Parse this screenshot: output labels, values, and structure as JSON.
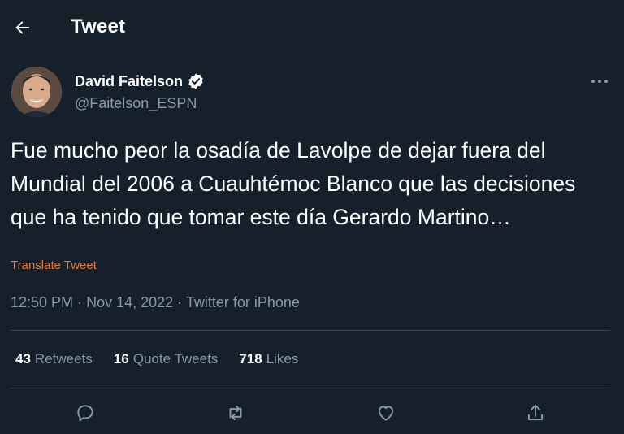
{
  "header": {
    "title": "Tweet",
    "back_icon": "arrow-left-icon"
  },
  "tweet": {
    "author": {
      "name": "David Faitelson",
      "handle": "@Faitelson_ESPN",
      "verified": true
    },
    "text": "Fue mucho peor la osadía de Lavolpe de dejar fuera del Mundial del 2006 a Cuauhtémoc Blanco que las decisiones que ha tenido que tomar este día Gerardo Martino…",
    "translate_label": "Translate Tweet",
    "time": "12:50 PM",
    "date": "Nov 14, 2022",
    "separator": "·",
    "source": "Twitter for iPhone",
    "stats": {
      "retweets_count": "43",
      "retweets_label": "Retweets",
      "quotes_count": "16",
      "quotes_label": "Quote Tweets",
      "likes_count": "718",
      "likes_label": "Likes"
    }
  },
  "colors": {
    "background": "#15202b",
    "text": "#ffffff",
    "secondary": "#8b98a5",
    "divider": "#38444d",
    "translate": "#e8772e",
    "verified": "#ffffff"
  },
  "actions": [
    "reply-icon",
    "retweet-icon",
    "like-icon",
    "share-icon"
  ]
}
